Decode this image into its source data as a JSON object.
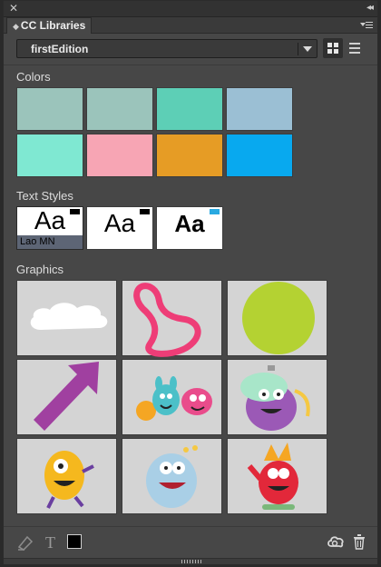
{
  "panel": {
    "tab_title": "CC Libraries",
    "tab_icon": "diamond-icon",
    "close_glyph": "✕",
    "collapse_glyph": "◂◂"
  },
  "library": {
    "selected": "firstEdition",
    "view": "grid"
  },
  "sections": {
    "colors_label": "Colors",
    "text_styles_label": "Text Styles",
    "graphics_label": "Graphics"
  },
  "colors": [
    "#9bc4bb",
    "#9bc4bb",
    "#5dcfb6",
    "#9bbfd4",
    "#7fe8d2",
    "#f7a5b4",
    "#e69c25",
    "#08a9ef"
  ],
  "text_styles": [
    {
      "sample": "Aa",
      "caption": "Lao MN",
      "corner": "black",
      "weight": "normal",
      "selected": true
    },
    {
      "sample": "Aa",
      "caption": "",
      "corner": "black",
      "weight": "normal",
      "selected": false
    },
    {
      "sample": "Aa",
      "caption": "",
      "corner": "blue",
      "weight": "bold",
      "selected": false
    }
  ],
  "graphics": [
    "cloud-graphic",
    "pink-loop-graphic",
    "green-circle-graphic",
    "purple-arrow-graphic",
    "monster-group-graphic",
    "purple-monster-graphic",
    "yellow-monster-graphic",
    "blue-monster-graphic",
    "red-monster-graphic"
  ],
  "footer": {
    "icons": [
      "add-color-icon",
      "add-text-style-icon",
      "add-fill-icon",
      "creative-cloud-icon",
      "trash-icon"
    ]
  },
  "accents": {
    "panel_bg": "#474747",
    "dark_bg": "#323232"
  }
}
